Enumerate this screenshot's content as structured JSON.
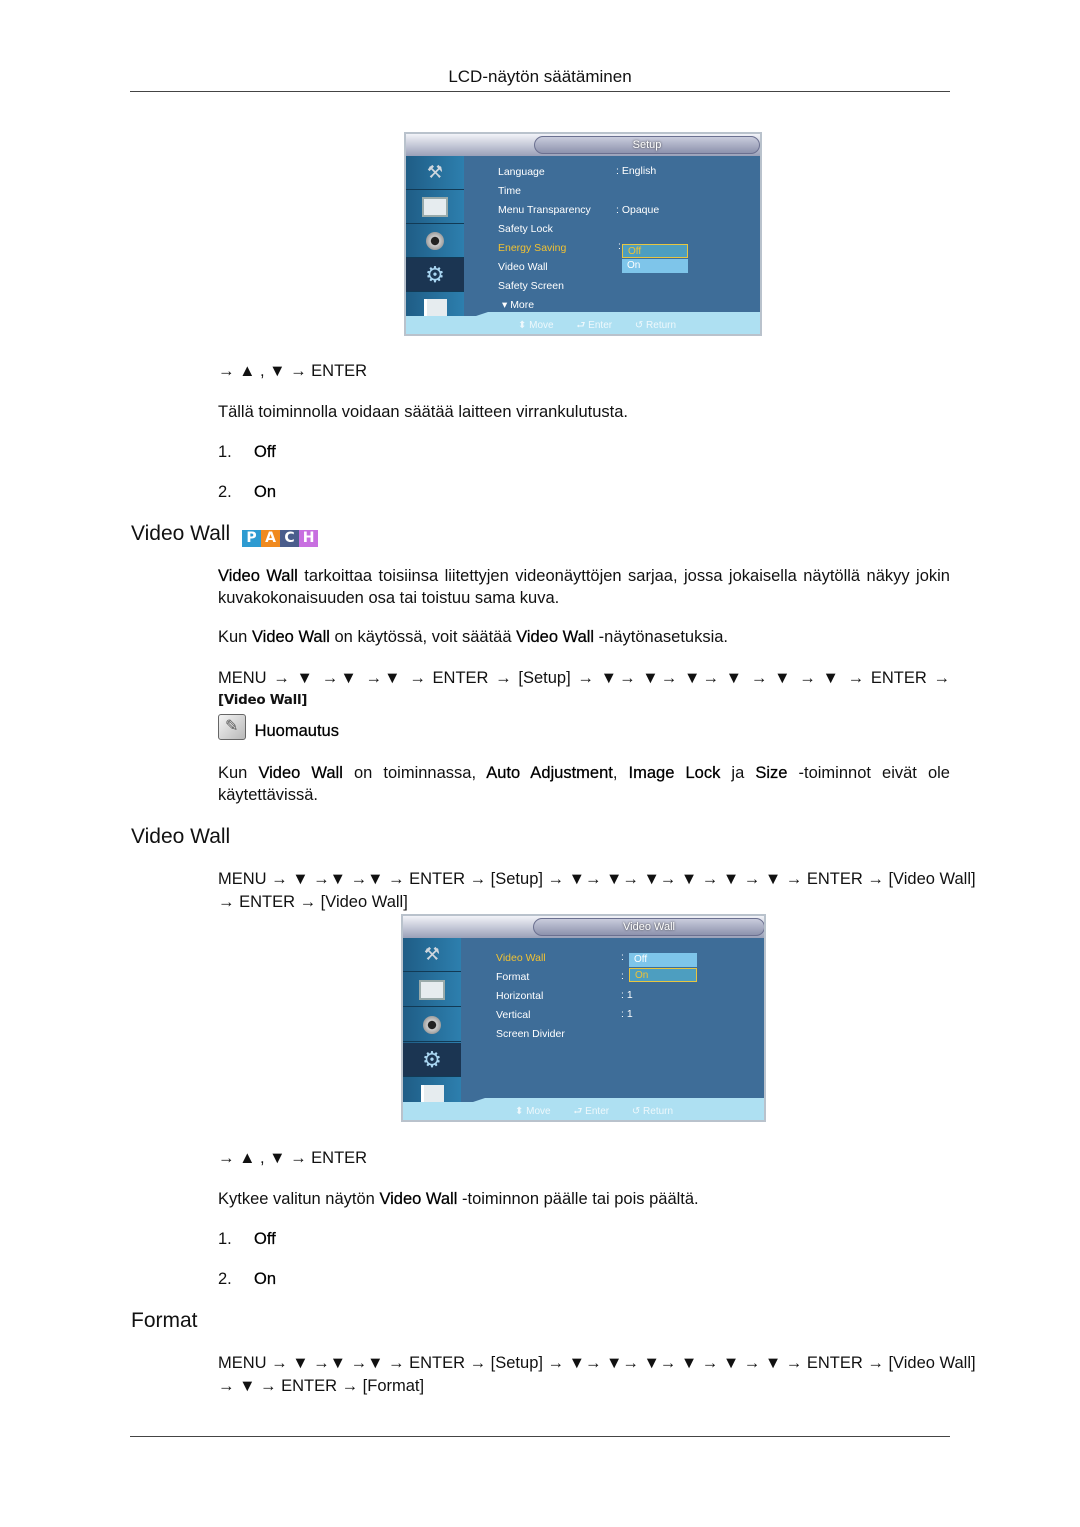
{
  "header": {
    "title": "LCD-näytön säätäminen"
  },
  "osd_setup": {
    "title": "Setup",
    "items": [
      {
        "label": "Language",
        "value": ": English"
      },
      {
        "label": "Time",
        "value": ""
      },
      {
        "label": "Menu Transparency",
        "value": ": Opaque"
      },
      {
        "label": "Safety Lock",
        "value": ""
      },
      {
        "label": "Energy Saving",
        "value": ":",
        "highlighted": true
      },
      {
        "label": "Video Wall",
        "value": ""
      },
      {
        "label": "Safety Screen",
        "value": ""
      },
      {
        "label": "▾ More",
        "value": ""
      }
    ],
    "options": [
      {
        "label": "Off",
        "selected": true
      },
      {
        "label": "On",
        "selected": false
      }
    ],
    "footer": {
      "move": "⬍ Move",
      "enter": "⮐ Enter",
      "return": "↺ Return"
    }
  },
  "section_energy": {
    "nav": "→ ▲ , ▼ → ENTER",
    "description": "Tällä toiminnolla voidaan säätää laitteen virrankulutusta.",
    "options": [
      {
        "num": "1.",
        "label": "Off"
      },
      {
        "num": "2.",
        "label": "On"
      }
    ]
  },
  "section_videowall_intro": {
    "heading": "Video Wall",
    "badges": [
      {
        "letter": "P",
        "color": "#2e9bd1"
      },
      {
        "letter": "A",
        "color": "#f08a1f"
      },
      {
        "letter": "C",
        "color": "#4a5d8c"
      },
      {
        "letter": "H",
        "color": "#c86fe0"
      }
    ],
    "para1_bold": "Video Wall",
    "para1_rest": " tarkoittaa toisiinsa liitettyjen videonäyttöjen sarjaa, jossa jokaisella näytöllä näkyy jokin kuvakokonaisuuden osa tai toistuu sama kuva.",
    "para2": [
      "Kun ",
      "Video Wall",
      " on käytössä, voit säätää ",
      "Video Wall",
      " -näytönasetuksia."
    ],
    "nav_line1": "MENU → ▼ →▼ →▼ → ENTER → [Setup] → ▼→ ▼→ ▼→ ▼ → ▼ → ▼ → ENTER →",
    "nav_line2": "[Video Wall]",
    "note_label": "Huomautus",
    "note_text": [
      "Kun ",
      "Video Wall",
      " on toiminnassa, ",
      "Auto Adjustment",
      ", ",
      "Image Lock",
      " ja ",
      "Size",
      " -toiminnot eivät ole käytettävissä."
    ]
  },
  "section_videowall": {
    "heading": "Video Wall",
    "nav_line1": "MENU → ▼ →▼ →▼ → ENTER → [Setup] → ▼→ ▼→ ▼→ ▼ → ▼ → ▼ → ENTER → [Video Wall]",
    "nav_line2": "→ ENTER → [Video Wall]",
    "nav_after": "→ ▲ , ▼ → ENTER",
    "description": [
      "Kytkee valitun näytön ",
      "Video Wall",
      " -toiminnon päälle tai pois päältä."
    ],
    "options": [
      {
        "num": "1.",
        "label": "Off"
      },
      {
        "num": "2.",
        "label": "On"
      }
    ]
  },
  "osd_videowall": {
    "title": "Video Wall",
    "items": [
      {
        "label": "Video Wall",
        "value": ":",
        "highlighted": true
      },
      {
        "label": "Format",
        "value": ":"
      },
      {
        "label": "Horizontal",
        "value": ": 1"
      },
      {
        "label": "Vertical",
        "value": ": 1"
      },
      {
        "label": "Screen Divider",
        "value": ""
      }
    ],
    "options": [
      {
        "label": "Off",
        "selected": false
      },
      {
        "label": "On",
        "selected": true
      }
    ],
    "footer": {
      "move": "⬍ Move",
      "enter": "⮐ Enter",
      "return": "↺ Return"
    }
  },
  "section_format": {
    "heading": "Format",
    "nav_line1": "MENU → ▼ →▼ →▼ → ENTER → [Setup] → ▼→ ▼→ ▼→ ▼ → ▼ → ▼ → ENTER → [Video Wall]",
    "nav_line2": "→ ▼ → ENTER → [Format]"
  }
}
